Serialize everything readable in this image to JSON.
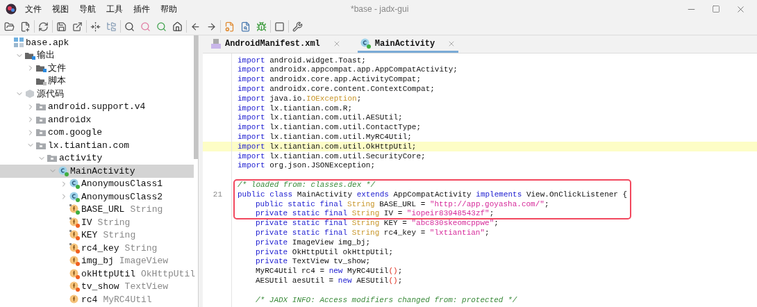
{
  "window": {
    "title": "*base - jadx-gui"
  },
  "menu": [
    "文件",
    "视图",
    "导航",
    "工具",
    "插件",
    "帮助"
  ],
  "tree": [
    {
      "label": "base.apk",
      "kind": "apk",
      "selected": false,
      "children": [
        {
          "label": "输出",
          "kind": "output",
          "expanded": true,
          "selected": false,
          "children": [
            {
              "label": "文件",
              "kind": "files",
              "expanded": false,
              "selected": false
            },
            {
              "label": "脚本",
              "kind": "scripts",
              "selected": false
            }
          ]
        },
        {
          "label": "源代码",
          "kind": "source",
          "expanded": true,
          "selected": false,
          "children": [
            {
              "label": "android.support.v4",
              "kind": "package",
              "expanded": false,
              "selected": false
            },
            {
              "label": "androidx",
              "kind": "package",
              "expanded": false,
              "selected": false
            },
            {
              "label": "com.google",
              "kind": "package",
              "expanded": false,
              "selected": false
            },
            {
              "label": "lx.tiantian.com",
              "kind": "package",
              "expanded": true,
              "selected": false,
              "children": [
                {
                  "label": "activity",
                  "kind": "package",
                  "expanded": true,
                  "selected": false,
                  "children": [
                    {
                      "label": "MainActivity",
                      "kind": "class",
                      "color": "#3fae3f",
                      "expanded": true,
                      "selected": true,
                      "children": [
                        {
                          "label": "AnonymousClass1",
                          "kind": "class",
                          "color": "#3fae3f",
                          "expanded": false,
                          "selected": false
                        },
                        {
                          "label": "AnonymousClass2",
                          "kind": "class",
                          "color": "#3fae3f",
                          "expanded": false,
                          "selected": false
                        },
                        {
                          "label": "BASE_URL",
                          "type": "String",
                          "kind": "static_field",
                          "color": "#3fae3f",
                          "selected": false
                        },
                        {
                          "label": "IV",
                          "type": "String",
                          "kind": "static_field",
                          "color": "#f06020",
                          "selected": false
                        },
                        {
                          "label": "KEY",
                          "type": "String",
                          "kind": "static_field",
                          "color": "#f06020",
                          "selected": false
                        },
                        {
                          "label": "rc4_key",
                          "type": "String",
                          "kind": "static_field",
                          "color": "#f06020",
                          "selected": false
                        },
                        {
                          "label": "img_bj",
                          "type": "ImageView",
                          "kind": "field",
                          "color": "#f06020",
                          "selected": false
                        },
                        {
                          "label": "okHttpUtil",
                          "type": "OkHttpUtil",
                          "kind": "field",
                          "color": "#f06020",
                          "selected": false
                        },
                        {
                          "label": "tv_show",
                          "type": "TextView",
                          "kind": "field",
                          "color": "#f06020",
                          "selected": false
                        },
                        {
                          "label": "rc4",
                          "type": "MyRC4Util",
                          "kind": "field",
                          "selected": false
                        }
                      ]
                    }
                  ]
                }
              ]
            }
          ]
        }
      ]
    }
  ],
  "tabs": [
    {
      "label": "AndroidManifest.xml",
      "kind": "manifest",
      "selected": false
    },
    {
      "label": "MainActivity",
      "kind": "class",
      "selected": true
    }
  ],
  "code": [
    {
      "kind": "line",
      "tokens": [
        {
          "kind": "keyword",
          "text": "import "
        },
        {
          "kind": "plain",
          "text": "android.widget.Toast;"
        }
      ]
    },
    {
      "kind": "line",
      "tokens": [
        {
          "kind": "keyword",
          "text": "import "
        },
        {
          "kind": "plain",
          "text": "androidx.appcompat.app.AppCompatActivity;"
        }
      ]
    },
    {
      "kind": "line",
      "tokens": [
        {
          "kind": "keyword",
          "text": "import "
        },
        {
          "kind": "plain",
          "text": "androidx.core.app.ActivityCompat;"
        }
      ]
    },
    {
      "kind": "line",
      "tokens": [
        {
          "kind": "keyword",
          "text": "import "
        },
        {
          "kind": "plain",
          "text": "androidx.core.content.ContextCompat;"
        }
      ]
    },
    {
      "kind": "line",
      "tokens": [
        {
          "kind": "keyword",
          "text": "import "
        },
        {
          "kind": "plain",
          "text": "java.io."
        },
        {
          "kind": "type",
          "text": "IOException"
        },
        {
          "kind": "plain",
          "text": ";"
        }
      ]
    },
    {
      "kind": "line",
      "tokens": [
        {
          "kind": "keyword",
          "text": "import "
        },
        {
          "kind": "plain",
          "text": "lx.tiantian.com.R;"
        }
      ]
    },
    {
      "kind": "line",
      "tokens": [
        {
          "kind": "keyword",
          "text": "import "
        },
        {
          "kind": "plain",
          "text": "lx.tiantian.com.util.AESUtil;"
        }
      ]
    },
    {
      "kind": "line",
      "tokens": [
        {
          "kind": "keyword",
          "text": "import "
        },
        {
          "kind": "plain",
          "text": "lx.tiantian.com.util.ContactType;"
        }
      ]
    },
    {
      "kind": "line",
      "tokens": [
        {
          "kind": "keyword",
          "text": "import "
        },
        {
          "kind": "plain",
          "text": "lx.tiantian.com.util.MyRC4Util;"
        }
      ]
    },
    {
      "kind": "line",
      "highlighted": true,
      "tokens": [
        {
          "kind": "keyword",
          "text": "import "
        },
        {
          "kind": "plain",
          "text": "lx.tiantian.com.util.OkHttpUtil;"
        }
      ]
    },
    {
      "kind": "line",
      "tokens": [
        {
          "kind": "keyword",
          "text": "import "
        },
        {
          "kind": "plain",
          "text": "lx.tiantian.com.util.SecurityCore;"
        }
      ]
    },
    {
      "kind": "line",
      "tokens": [
        {
          "kind": "keyword",
          "text": "import "
        },
        {
          "kind": "plain",
          "text": "org.json.JSONException;"
        }
      ]
    },
    {
      "kind": "blank"
    },
    {
      "kind": "line",
      "boxed": true,
      "tokens": [
        {
          "kind": "comment",
          "text": "/* loaded from: classes.dex */"
        }
      ]
    },
    {
      "kind": "line",
      "boxed": true,
      "line_number": "21",
      "tokens": [
        {
          "kind": "keyword",
          "text": "public class "
        },
        {
          "kind": "plain",
          "text": "MainActivity "
        },
        {
          "kind": "keyword",
          "text": "extends "
        },
        {
          "kind": "plain",
          "text": "AppCompatActivity "
        },
        {
          "kind": "keyword",
          "text": "implements "
        },
        {
          "kind": "plain",
          "text": "View.OnClickListener {"
        }
      ],
      "children": [
        {
          "kind": "line",
          "boxed": true,
          "tokens": [
            {
              "kind": "keyword",
              "text": "public static final "
            },
            {
              "kind": "type",
              "text": "String "
            },
            {
              "kind": "plain",
              "text": "BASE_URL = "
            },
            {
              "kind": "string",
              "text": "\"http://app.goyasha.com/\""
            },
            {
              "kind": "plain",
              "text": ";"
            }
          ]
        },
        {
          "kind": "line",
          "boxed": true,
          "tokens": [
            {
              "kind": "keyword",
              "text": "private static final "
            },
            {
              "kind": "type",
              "text": "String "
            },
            {
              "kind": "plain",
              "text": "IV = "
            },
            {
              "kind": "string",
              "text": "\"iopeir83948543zf\""
            },
            {
              "kind": "plain",
              "text": ";"
            }
          ]
        },
        {
          "kind": "line",
          "tokens": [
            {
              "kind": "keyword",
              "text": "private static final "
            },
            {
              "kind": "type",
              "text": "String "
            },
            {
              "kind": "plain",
              "text": "KEY = "
            },
            {
              "kind": "string",
              "text": "\"abc830skeomcppwe\""
            },
            {
              "kind": "plain",
              "text": ";"
            }
          ]
        },
        {
          "kind": "line",
          "tokens": [
            {
              "kind": "keyword",
              "text": "private static final "
            },
            {
              "kind": "type",
              "text": "String "
            },
            {
              "kind": "plain",
              "text": "rc4_key = "
            },
            {
              "kind": "string",
              "text": "\"lxtiantian\""
            },
            {
              "kind": "plain",
              "text": ";"
            }
          ]
        },
        {
          "kind": "line",
          "tokens": [
            {
              "kind": "keyword",
              "text": "private "
            },
            {
              "kind": "plain",
              "text": "ImageView img_bj;"
            }
          ]
        },
        {
          "kind": "line",
          "tokens": [
            {
              "kind": "keyword",
              "text": "private "
            },
            {
              "kind": "plain",
              "text": "OkHttpUtil okHttpUtil;"
            }
          ]
        },
        {
          "kind": "line",
          "tokens": [
            {
              "kind": "keyword",
              "text": "private "
            },
            {
              "kind": "plain",
              "text": "TextView tv_show;"
            }
          ]
        },
        {
          "kind": "line",
          "tokens": [
            {
              "kind": "plain",
              "text": "MyRC4Util rc4 = "
            },
            {
              "kind": "keyword",
              "text": "new "
            },
            {
              "kind": "plain",
              "text": "MyRC4Util"
            },
            {
              "kind": "paren",
              "text": "()"
            },
            {
              "kind": "plain",
              "text": ";"
            }
          ]
        },
        {
          "kind": "line",
          "tokens": [
            {
              "kind": "plain",
              "text": "AESUtil aesUtil = "
            },
            {
              "kind": "keyword",
              "text": "new "
            },
            {
              "kind": "plain",
              "text": "AESUtil"
            },
            {
              "kind": "paren",
              "text": "()"
            },
            {
              "kind": "plain",
              "text": ";"
            }
          ]
        },
        {
          "kind": "blank"
        },
        {
          "kind": "line",
          "tokens": [
            {
              "kind": "comment",
              "text": "/* JADX INFO: Access modifiers changed from: protected */"
            }
          ]
        }
      ]
    }
  ]
}
